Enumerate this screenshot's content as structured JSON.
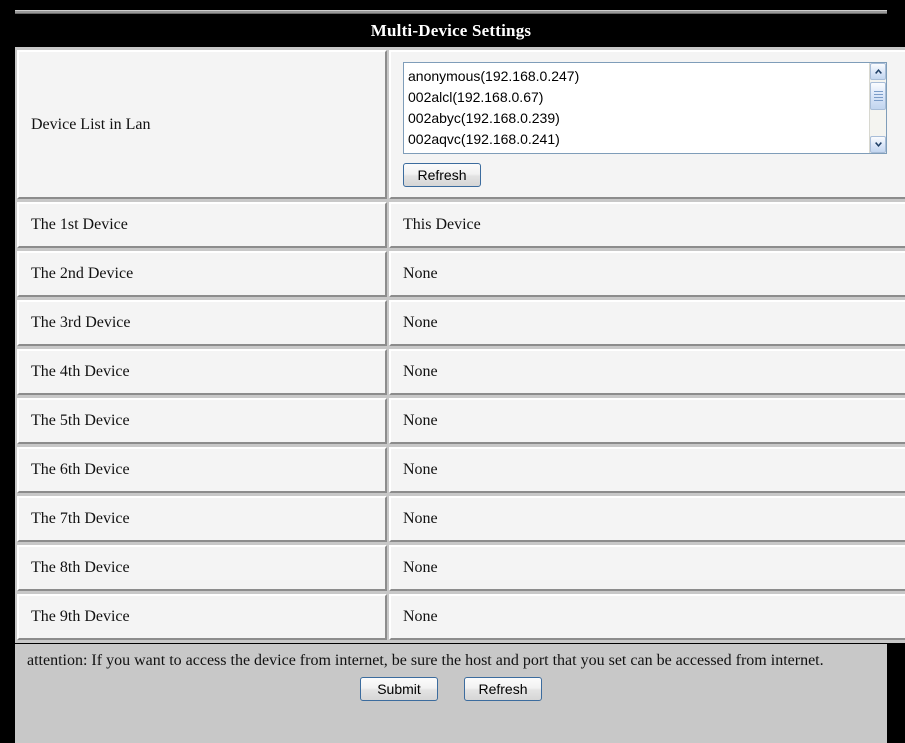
{
  "window": {
    "title": "Multi-Device Settings"
  },
  "device_list": {
    "label": "Device List in Lan",
    "items": [
      "anonymous(192.168.0.247)",
      "002alcl(192.168.0.67)",
      "002abyc(192.168.0.239)",
      "002aqvc(192.168.0.241)"
    ],
    "refresh_label": "Refresh",
    "scrollbar": {
      "up_icon": "chevron-up-icon",
      "down_icon": "chevron-down-icon"
    }
  },
  "devices": [
    {
      "label": "The 1st Device",
      "value": "This Device"
    },
    {
      "label": "The 2nd Device",
      "value": "None"
    },
    {
      "label": "The 3rd Device",
      "value": "None"
    },
    {
      "label": "The 4th Device",
      "value": "None"
    },
    {
      "label": "The 5th Device",
      "value": "None"
    },
    {
      "label": "The 6th Device",
      "value": "None"
    },
    {
      "label": "The 7th Device",
      "value": "None"
    },
    {
      "label": "The 8th Device",
      "value": "None"
    },
    {
      "label": "The 9th Device",
      "value": "None"
    }
  ],
  "footer": {
    "attention": "attention: If you want to access the device from internet, be sure the host and port that you set can be accessed from internet.",
    "submit_label": "Submit",
    "refresh_label": "Refresh"
  },
  "colors": {
    "frame": "#000000",
    "panel_bg": "#c8c8c8",
    "cell_bg": "#f4f4f4",
    "title_text": "#ffffff",
    "button_border": "#3c6c9e",
    "scroll_accent": "#a8bdd8"
  }
}
